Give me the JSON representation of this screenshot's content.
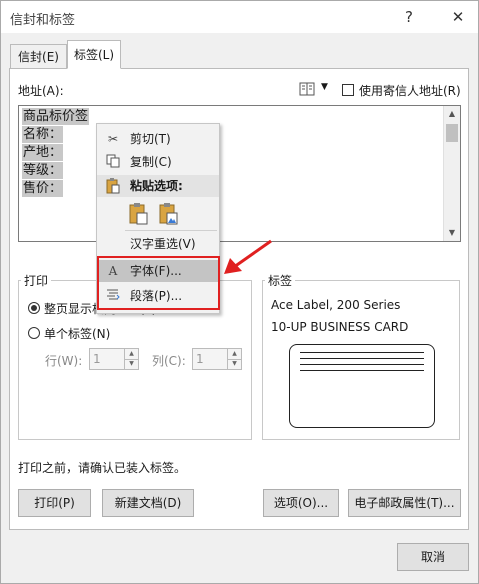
{
  "window": {
    "title": "信封和标签",
    "help": "?",
    "close": "✕"
  },
  "tabs": [
    {
      "label": "信封(E)"
    },
    {
      "label": "标签(L)"
    }
  ],
  "address": {
    "label": "地址(A):",
    "use_return_address_label": "使用寄信人地址(R)",
    "lines": [
      "商品标价签",
      "名称：",
      "产地：",
      "等级：",
      "售价："
    ]
  },
  "print_group": {
    "title": "打印",
    "full_page_label": "整页显示相同标签(F)",
    "single_label": "单个标签(N)",
    "row_label": "行(W):",
    "row_value": "1",
    "col_label": "列(C):",
    "col_value": "1"
  },
  "label_group": {
    "title": "标签",
    "line1": "Ace Label, 200 Series",
    "line2": "10-UP BUSINESS CARD"
  },
  "notice": "打印之前，请确认已装入标签。",
  "buttons": {
    "print": "打印(P)",
    "new_doc": "新建文档(D)",
    "options": "选项(O)...",
    "epostage": "电子邮政属性(T)...",
    "cancel": "取消"
  },
  "context_menu": {
    "cut": "剪切(T)",
    "copy": "复制(C)",
    "paste_options": "粘贴选项:",
    "reconvert": "汉字重选(V)",
    "font": "字体(F)...",
    "paragraph": "段落(P)..."
  },
  "colors": {
    "highlight_border": "#e02020",
    "arrow": "#e02020"
  }
}
